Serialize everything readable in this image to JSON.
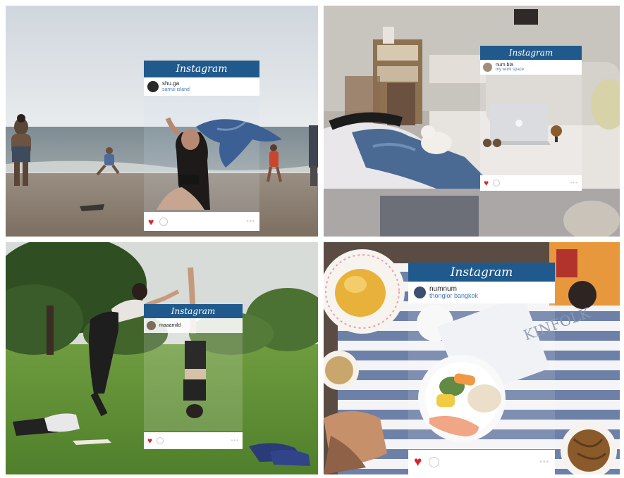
{
  "panels": [
    {
      "username": "shu.ga",
      "location": "samui island"
    },
    {
      "username": "num.bla",
      "location": "my work space"
    },
    {
      "username": "maaamild",
      "location": ""
    },
    {
      "username": "numnum",
      "location": "thonglor bangkok"
    }
  ],
  "brand": "Instagram",
  "book_title": "KINFOLK",
  "colors": {
    "instagram_header": "#205a8c",
    "heart": "#d8262e",
    "location_text": "#4a7ab0"
  },
  "icons": [
    "heart-icon",
    "comment-icon",
    "more-dots-icon"
  ]
}
